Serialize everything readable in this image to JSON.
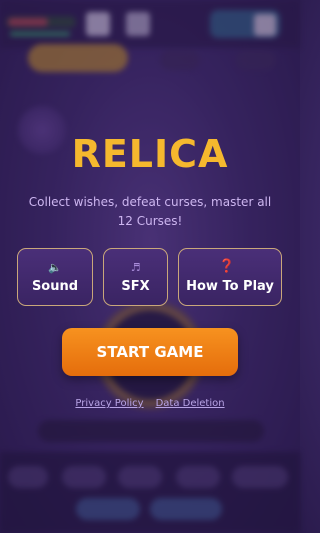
{
  "menu": {
    "title": "RELICA",
    "subtitle": "Collect wishes, defeat curses, master all 12 Curses!",
    "buttons": {
      "sound": {
        "icon": "speaker-icon",
        "glyph": "🔈",
        "label": "Sound"
      },
      "sfx": {
        "icon": "music-note-icon",
        "glyph": "♬",
        "label": "SFX"
      },
      "how_to_play": {
        "icon": "question-mark-icon",
        "glyph": "❓",
        "label": "How To Play"
      }
    },
    "start_label": "START GAME",
    "links": {
      "privacy": "Privacy Policy",
      "data_deletion": "Data Deletion"
    }
  },
  "colors": {
    "title": "#f5b82e",
    "start_button": "#f08418",
    "button_border": "#c9a77a",
    "background": "#3e2a6a"
  }
}
